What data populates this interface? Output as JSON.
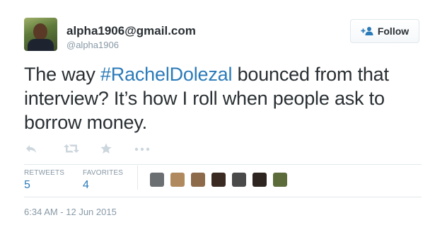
{
  "tweet": {
    "author_name": "alpha1906@gmail.com",
    "author_handle": "@alpha1906",
    "text_before": "The way ",
    "hashtag": "#RachelDolezal",
    "text_after": " bounced from that interview? It’s how I roll when people ask to borrow money.",
    "timestamp": "6:34 AM - 12 Jun 2015"
  },
  "follow_button": {
    "label": "Follow",
    "icon": "follow-person-plus-icon"
  },
  "actions": [
    {
      "name": "reply",
      "icon": "reply-icon"
    },
    {
      "name": "retweet",
      "icon": "retweet-icon"
    },
    {
      "name": "favorite",
      "icon": "star-icon"
    },
    {
      "name": "more",
      "icon": "more-dots-icon"
    }
  ],
  "stats": {
    "retweets_label": "RETWEETS",
    "retweets_count": "5",
    "favorites_label": "FAVORITES",
    "favorites_count": "4"
  },
  "favoriters": [
    {
      "name": "favoriter-1",
      "color": "#6b6f72"
    },
    {
      "name": "favoriter-2",
      "color": "#b08a5e"
    },
    {
      "name": "favoriter-3",
      "color": "#8c6a4a"
    },
    {
      "name": "favoriter-4",
      "color": "#3a2a22"
    },
    {
      "name": "favoriter-5",
      "color": "#4a4a4a"
    },
    {
      "name": "favoriter-6",
      "color": "#2e2520"
    },
    {
      "name": "favoriter-7",
      "color": "#5b6b3a"
    }
  ],
  "colors": {
    "link": "#2b7bb9",
    "muted": "#8899a6",
    "text": "#292f33",
    "border": "#e1e8ed"
  }
}
